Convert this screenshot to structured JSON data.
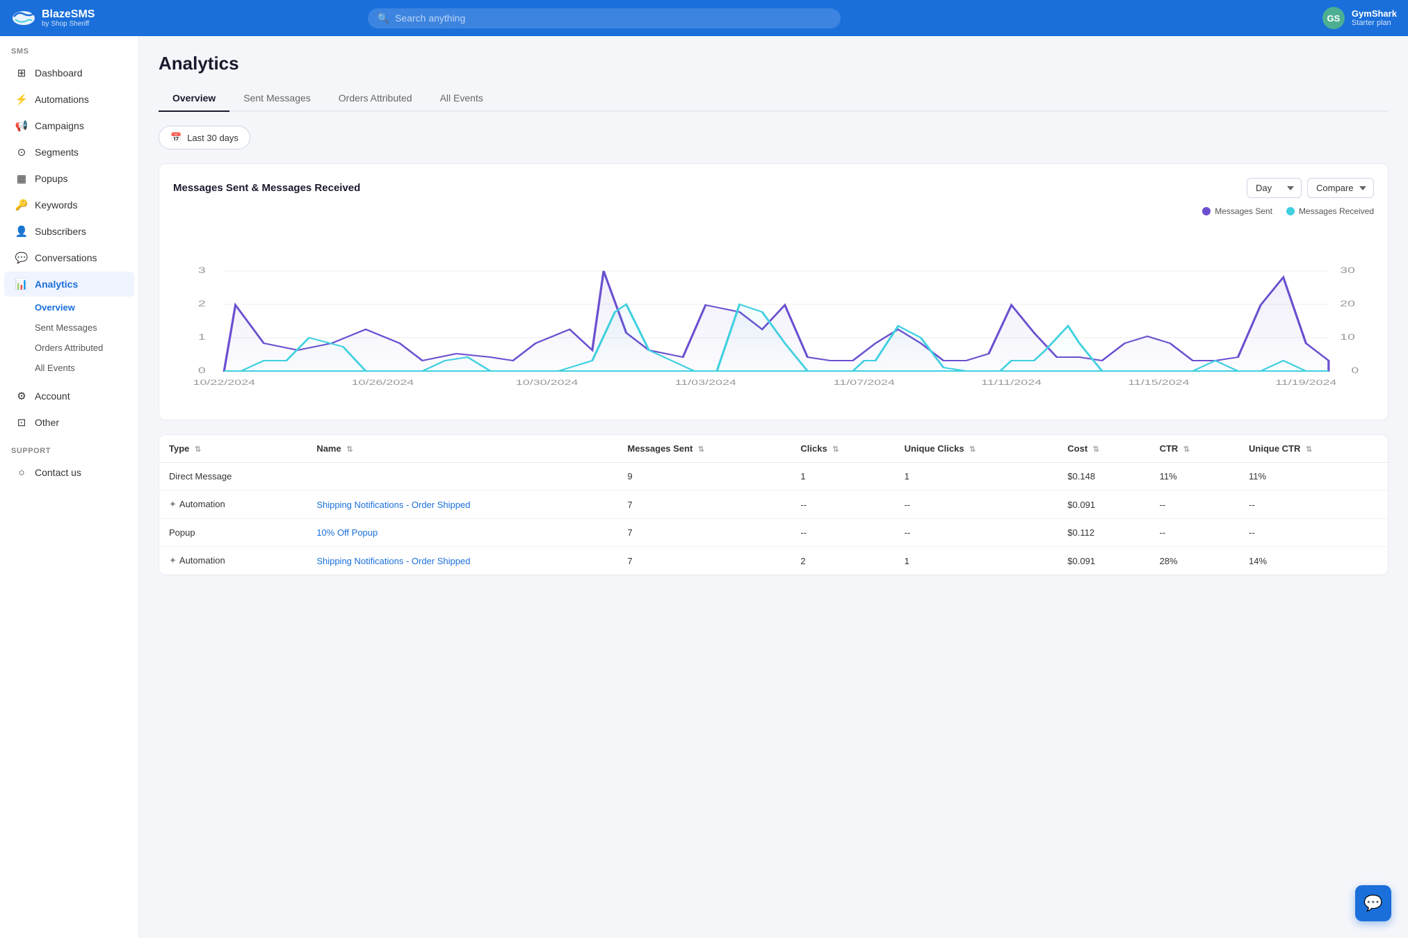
{
  "header": {
    "logo_title": "BlazeSMS",
    "logo_sub": "by Shop Sheriff",
    "search_placeholder": "Search anything",
    "user_initials": "GS",
    "user_name": "GymShark",
    "user_plan": "Starter plan"
  },
  "sidebar": {
    "sms_label": "SMS",
    "items": [
      {
        "id": "dashboard",
        "label": "Dashboard",
        "icon": "⊞"
      },
      {
        "id": "automations",
        "label": "Automations",
        "icon": "⚡"
      },
      {
        "id": "campaigns",
        "label": "Campaigns",
        "icon": "📢"
      },
      {
        "id": "segments",
        "label": "Segments",
        "icon": "⊙"
      },
      {
        "id": "popups",
        "label": "Popups",
        "icon": "▦"
      },
      {
        "id": "keywords",
        "label": "Keywords",
        "icon": "🔑"
      },
      {
        "id": "subscribers",
        "label": "Subscribers",
        "icon": "👤"
      },
      {
        "id": "conversations",
        "label": "Conversations",
        "icon": "💬"
      },
      {
        "id": "analytics",
        "label": "Analytics",
        "icon": "📊"
      }
    ],
    "analytics_sub": [
      {
        "id": "overview",
        "label": "Overview",
        "active": true
      },
      {
        "id": "sent-messages",
        "label": "Sent Messages"
      },
      {
        "id": "orders-attributed",
        "label": "Orders Attributed"
      },
      {
        "id": "all-events",
        "label": "All Events"
      }
    ],
    "account_items": [
      {
        "id": "account",
        "label": "Account",
        "icon": "⚙"
      },
      {
        "id": "other",
        "label": "Other",
        "icon": "⊡"
      }
    ],
    "support_label": "Support",
    "support_items": [
      {
        "id": "contact-us",
        "label": "Contact us",
        "icon": "○"
      }
    ]
  },
  "page": {
    "title": "Analytics",
    "tabs": [
      "Overview",
      "Sent Messages",
      "Orders Attributed",
      "All Events"
    ],
    "active_tab": "Overview"
  },
  "filter": {
    "date_label": "Last 30 days"
  },
  "chart": {
    "title": "Messages Sent & Messages Received",
    "day_label": "Day",
    "compare_label": "Compare",
    "legend_sent": "Messages Sent",
    "legend_received": "Messages Received",
    "sent_color": "#6b4fcf",
    "received_color": "#40d0e0",
    "x_labels": [
      "10/22/2024",
      "10/26/2024",
      "10/30/2024",
      "11/03/2024",
      "11/07/2024",
      "11/11/2024",
      "11/15/2024",
      "11/19/2024"
    ],
    "y_left_labels": [
      "0",
      "1",
      "2",
      "3"
    ],
    "y_right_labels": [
      "0",
      "10",
      "20",
      "30"
    ]
  },
  "table": {
    "columns": [
      {
        "key": "type",
        "label": "Type"
      },
      {
        "key": "name",
        "label": "Name"
      },
      {
        "key": "messages_sent",
        "label": "Messages Sent"
      },
      {
        "key": "clicks",
        "label": "Clicks"
      },
      {
        "key": "unique_clicks",
        "label": "Unique Clicks"
      },
      {
        "key": "cost",
        "label": "Cost"
      },
      {
        "key": "ctr",
        "label": "CTR"
      },
      {
        "key": "unique_ctr",
        "label": "Unique CTR"
      }
    ],
    "rows": [
      {
        "type": "Direct Message",
        "name": "",
        "messages_sent": "9",
        "clicks": "1",
        "unique_clicks": "1",
        "cost": "$0.148",
        "ctr": "11%",
        "unique_ctr": "11%",
        "is_link": false,
        "is_automation": false
      },
      {
        "type": "Automation",
        "name": "Shipping Notifications - Order Shipped",
        "messages_sent": "7",
        "clicks": "--",
        "unique_clicks": "--",
        "cost": "$0.091",
        "ctr": "--",
        "unique_ctr": "--",
        "is_link": true,
        "is_automation": true
      },
      {
        "type": "Popup",
        "name": "10% Off Popup",
        "messages_sent": "7",
        "clicks": "--",
        "unique_clicks": "--",
        "cost": "$0.112",
        "ctr": "--",
        "unique_ctr": "--",
        "is_link": true,
        "is_automation": false
      },
      {
        "type": "Automation",
        "name": "Shipping Notifications - Order Shipped",
        "messages_sent": "7",
        "clicks": "2",
        "unique_clicks": "1",
        "cost": "$0.091",
        "ctr": "28%",
        "unique_ctr": "14%",
        "is_link": true,
        "is_automation": true
      }
    ]
  },
  "chat_fab_icon": "💬"
}
